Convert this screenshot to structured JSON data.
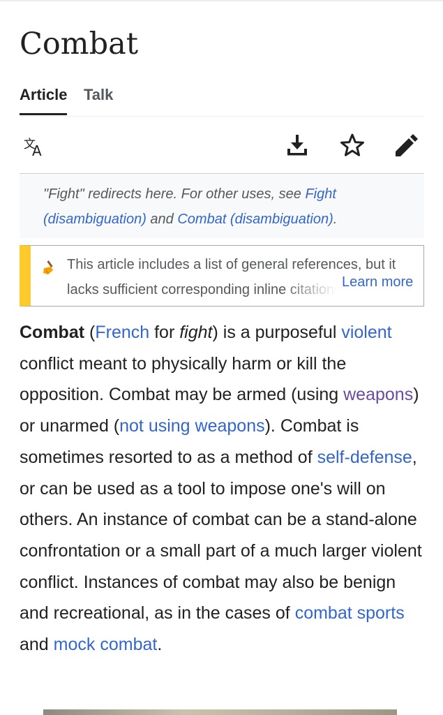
{
  "article": {
    "title": "Combat",
    "tabs": [
      {
        "label": "Article",
        "active": true
      },
      {
        "label": "Talk",
        "active": false
      }
    ]
  },
  "toolbar": {
    "icons": [
      "translate-icon",
      "download-icon",
      "star-icon",
      "edit-pencil-icon"
    ]
  },
  "hatnote": {
    "prefix": "\"Fight\" redirects here. For other uses, see ",
    "link1": "Fight (disambiguation)",
    "middle": " and ",
    "link2": "Combat (disambiguation)",
    "suffix": "."
  },
  "notice": {
    "text": "This article includes a list of general references, but it lacks sufficient corresponding inline citations.",
    "learn_more": "Learn more",
    "accent_color": "#fdca2e",
    "icon": "broom-icon"
  },
  "lead": {
    "bold": "Combat",
    "t1": " (",
    "l_french": "French",
    "t2": " for ",
    "i_fight": "fight",
    "t3": ") is a purposeful ",
    "l_violent": "violent",
    "t4": " conflict meant to physically harm or kill the opposition. Combat may be armed (using ",
    "l_weapons": "weapons",
    "t5": ") or unarmed (",
    "l_not_using": "not using weapons",
    "t6": "). Combat is sometimes resorted to as a method of ",
    "l_self_defense": "self-defense",
    "t7": ", or can be used as a tool to impose one's will on others. An instance of combat can be a stand-alone confrontation or a small part of a much larger violent conflict. Instances of combat may also be benign and recreational, as in the cases of ",
    "l_combat_sports": "combat sports",
    "t8": " and ",
    "l_mock_combat": "mock combat",
    "t9": "."
  },
  "colors": {
    "link": "#3366cc",
    "visited_link": "#6b4ba1",
    "text": "#202122"
  }
}
